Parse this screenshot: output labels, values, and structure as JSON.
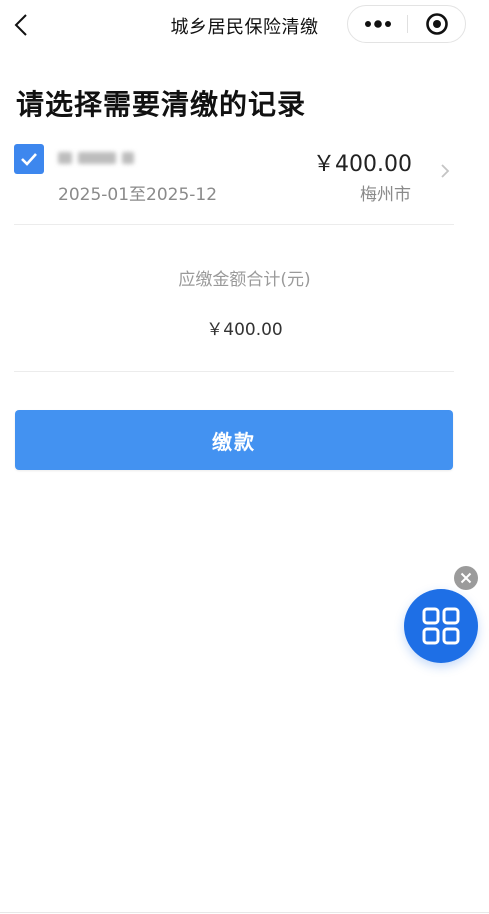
{
  "nav": {
    "title": "城乡居民保险清缴",
    "back_icon": "chevron-left-icon",
    "more_icon": "more-dots-icon",
    "close_icon": "target-circle-icon"
  },
  "page": {
    "heading": "请选择需要清缴的记录"
  },
  "record": {
    "checked": true,
    "period": "2025-01至2025-12",
    "amount": "￥400.00",
    "city": "梅州市"
  },
  "summary": {
    "label": "应缴金额合计(元)",
    "value": "￥400.00"
  },
  "actions": {
    "pay_label": "缴款"
  },
  "colors": {
    "accent": "#4392f1",
    "checkbox": "#3d87ee",
    "float_button": "#1e6fe6"
  }
}
